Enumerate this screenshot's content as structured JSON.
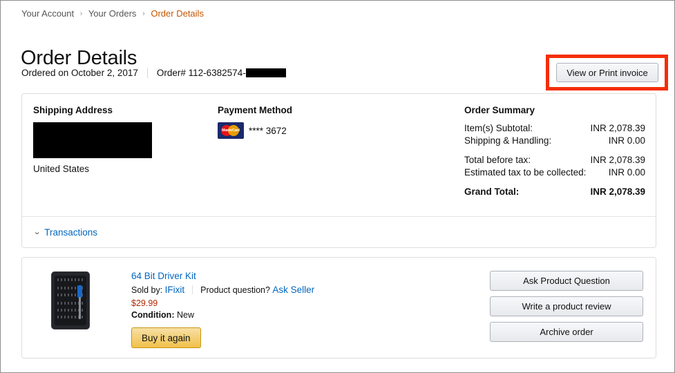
{
  "breadcrumb": {
    "items": [
      {
        "label": "Your Account",
        "current": false
      },
      {
        "label": "Your Orders",
        "current": false
      },
      {
        "label": "Order Details",
        "current": true
      }
    ],
    "separator": "›"
  },
  "header": {
    "title": "Order Details",
    "ordered_on": "Ordered on October 2, 2017",
    "order_number": "Order# 112-6382574-",
    "order_number_redacted": true,
    "invoice_button": "View or Print invoice",
    "annotation_color": "#f42e06"
  },
  "shipping": {
    "heading": "Shipping Address",
    "address_redacted": true,
    "country": "United States"
  },
  "payment": {
    "heading": "Payment Method",
    "card_brand": "MasterCard",
    "card_brand_short": "MasterCard",
    "card_digits": "**** 3672"
  },
  "order_summary": {
    "heading": "Order Summary",
    "rows": [
      {
        "label": "Item(s) Subtotal:",
        "value": "INR 2,078.39",
        "gap_above": false,
        "bold": false
      },
      {
        "label": "Shipping & Handling:",
        "value": "INR 0.00",
        "gap_above": false,
        "bold": false
      },
      {
        "label": "Total before tax:",
        "value": "INR 2,078.39",
        "gap_above": true,
        "bold": false
      },
      {
        "label": "Estimated tax to be collected:",
        "value": "INR 0.00",
        "gap_above": false,
        "bold": false
      },
      {
        "label": "Grand Total:",
        "value": "INR 2,078.39",
        "gap_above": true,
        "bold": true
      }
    ]
  },
  "transactions": {
    "label": "Transactions",
    "chevron": "⌄"
  },
  "product": {
    "title": "64 Bit Driver Kit",
    "sold_by_label": "Sold by:",
    "seller": "IFixit",
    "question_label": "Product question?",
    "ask_seller": "Ask Seller",
    "price": "$29.99",
    "condition_label": "Condition:",
    "condition_value": "New",
    "buy_again": "Buy it again",
    "thumbnail_alt": "64 bit driver kit case"
  },
  "product_actions": {
    "buttons": [
      "Ask Product Question",
      "Write a product review",
      "Archive order"
    ]
  }
}
